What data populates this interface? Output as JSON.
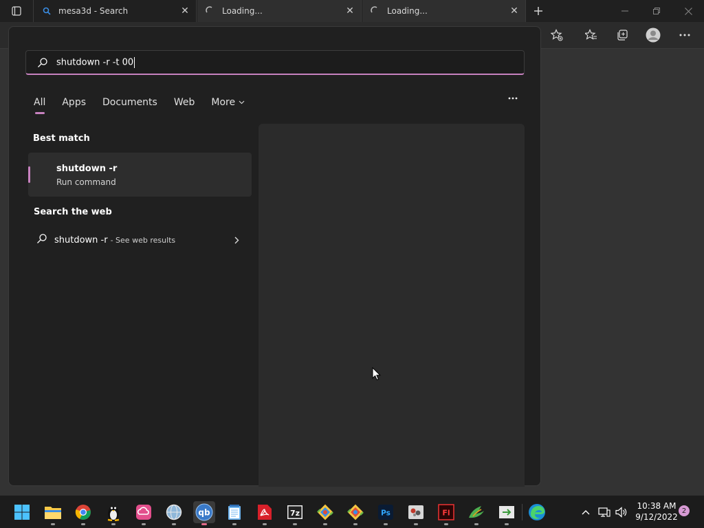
{
  "browser": {
    "tabs": [
      {
        "title": "mesa3d - Search",
        "icon": "search-icon"
      },
      {
        "title": "Loading...",
        "icon": "loading-spinner-icon"
      },
      {
        "title": "Loading...",
        "icon": "loading-spinner-icon"
      }
    ],
    "close_glyph": "✕"
  },
  "search": {
    "value": "shutdown -r -t 00"
  },
  "filters": [
    {
      "label": "All",
      "active": true
    },
    {
      "label": "Apps"
    },
    {
      "label": "Documents"
    },
    {
      "label": "Web"
    },
    {
      "label": "More"
    }
  ],
  "best_match": {
    "heading": "Best match",
    "title": "shutdown -r",
    "subtitle": "Run command"
  },
  "web": {
    "heading": "Search the web",
    "query": "shutdown -r",
    "suffix": " - See web results"
  },
  "taskbar": {
    "apps": [
      "start-icon",
      "file-explorer-icon",
      "chrome-icon",
      "penguin-app-icon",
      "creative-cloud-icon",
      "globe-app-icon",
      "qbittorrent-icon",
      "notepad-icon",
      "acrobat-icon",
      "7zip-icon",
      "git-gui-icon",
      "git-gui-icon",
      "photoshop-icon",
      "app-icon",
      "flash-icon",
      "bird-app-icon",
      "terminal-icon",
      "edge-icon"
    ],
    "qb_label": "qb",
    "ps_label": "Ps",
    "fl_label": "Fl",
    "sevenzip_label": "7z"
  },
  "clock": {
    "time": "10:38 AM",
    "date": "9/12/2022"
  },
  "notifications": {
    "count": "2"
  },
  "colors": {
    "accent": "#c882c0"
  }
}
